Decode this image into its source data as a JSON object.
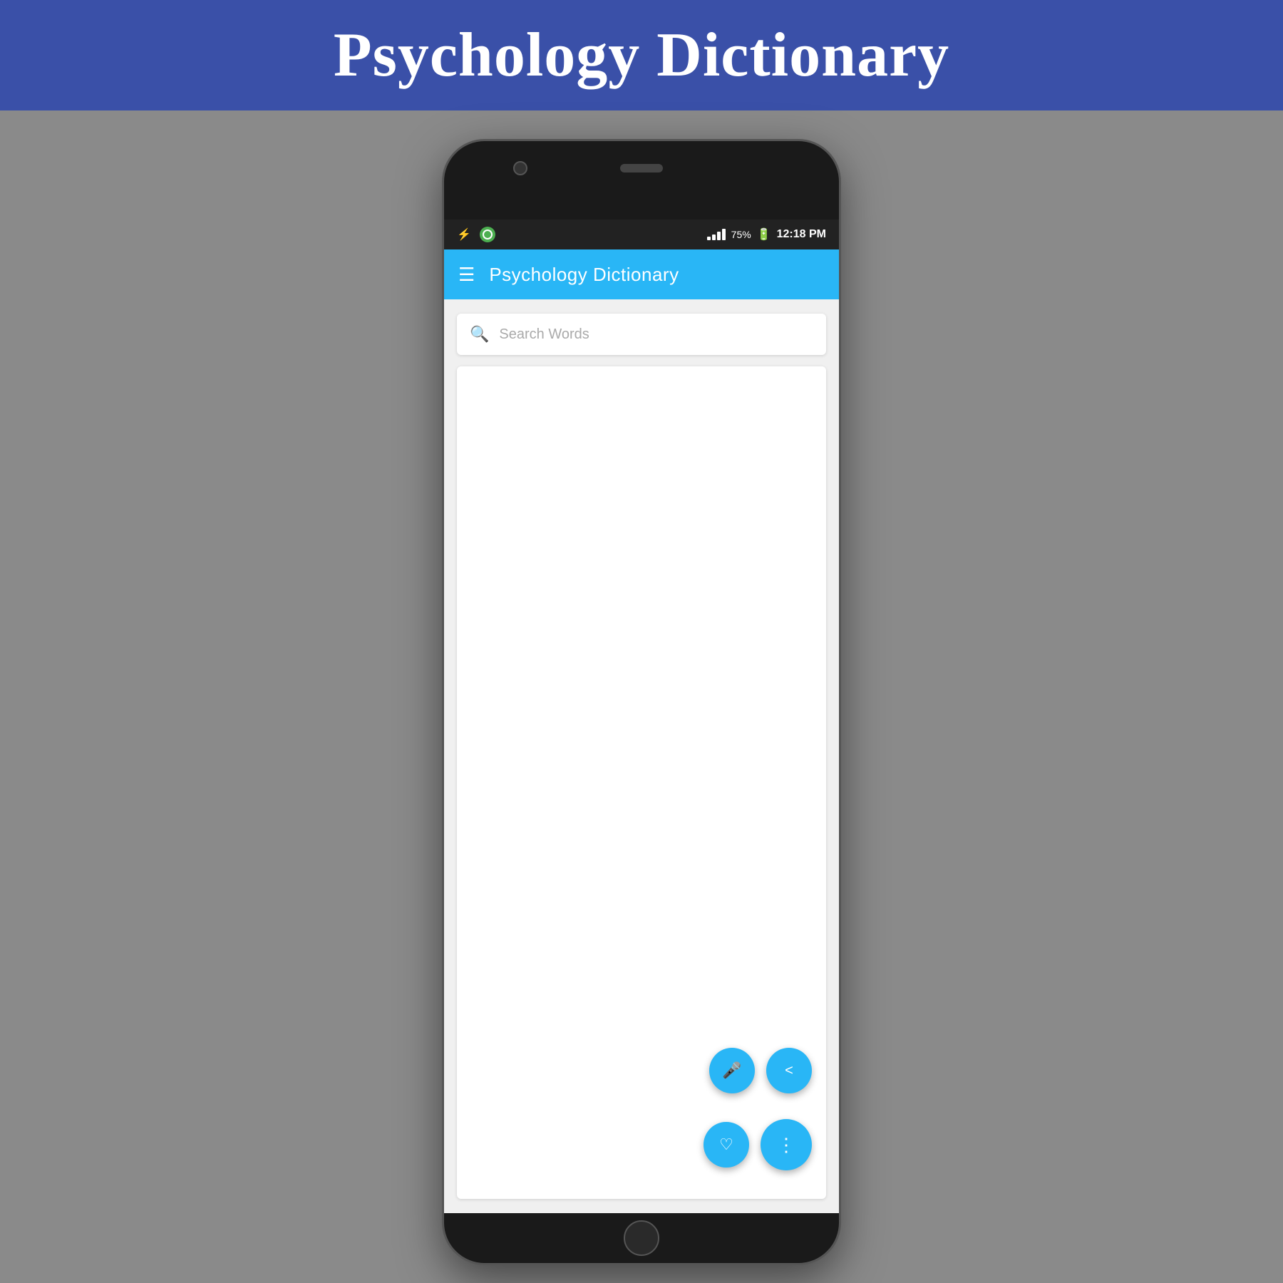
{
  "banner": {
    "title": "Psychology Dictionary",
    "background_color": "#3a50a8"
  },
  "phone": {
    "status_bar": {
      "time": "12:18 PM",
      "battery_percent": "75%",
      "signal_bars": [
        4,
        8,
        12,
        16,
        20
      ]
    },
    "app_bar": {
      "title": "Psychology Dictionary",
      "background_color": "#29b6f6"
    },
    "search": {
      "placeholder": "Search Words"
    },
    "fab_buttons": [
      {
        "icon": "share",
        "label": "share-button",
        "unicode": "⇗"
      },
      {
        "icon": "mic",
        "label": "mic-button",
        "unicode": "🎤"
      },
      {
        "icon": "favorite",
        "label": "favorite-button",
        "unicode": "♡"
      },
      {
        "icon": "more",
        "label": "more-button",
        "unicode": "⋮"
      }
    ]
  }
}
